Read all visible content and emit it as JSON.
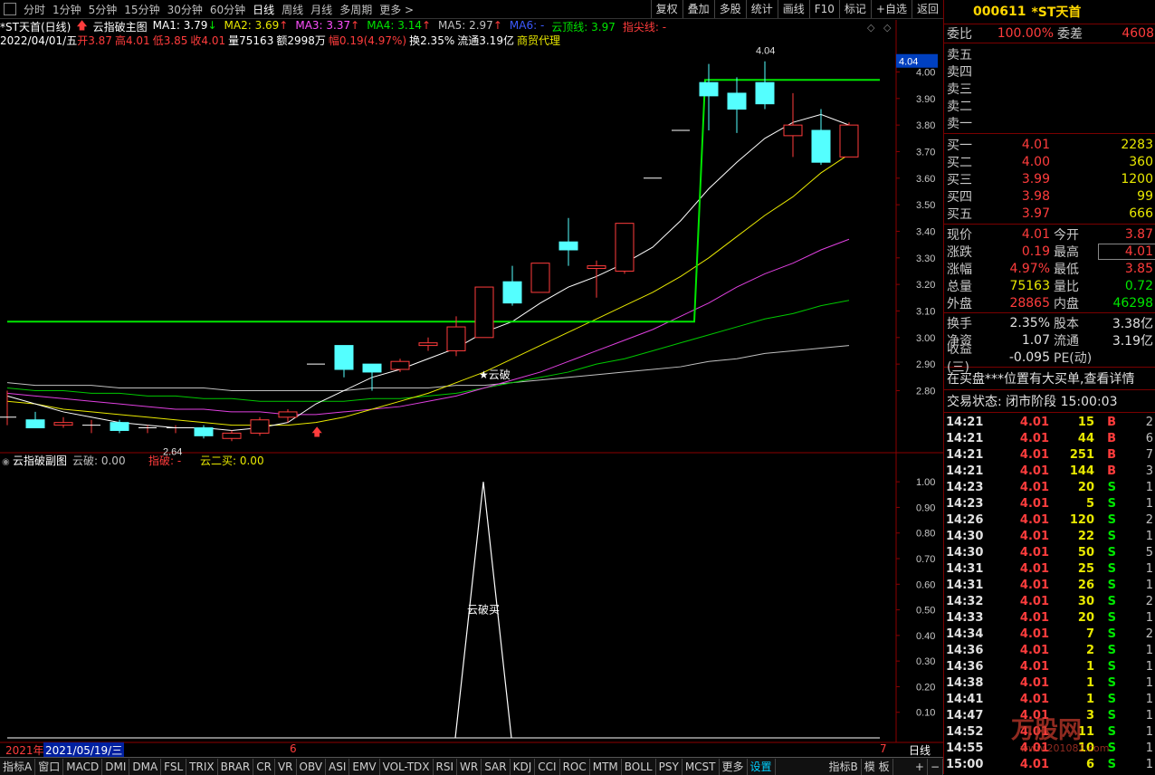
{
  "topbar": {
    "periods": [
      "分时",
      "1分钟",
      "5分钟",
      "15分钟",
      "30分钟",
      "60分钟",
      "日线",
      "周线",
      "月线",
      "多周期",
      "更多 >"
    ],
    "active_period": "日线",
    "buttons": [
      "复权",
      "叠加",
      "多股",
      "统计",
      "画线",
      "F10",
      "标记",
      "+自选",
      "返回"
    ]
  },
  "main": {
    "title": "*ST天首(日线)",
    "indicator_name": "云指破主图",
    "ma": [
      {
        "label": "MA1: 3.79",
        "arrow": "↓",
        "color": "#ffffff"
      },
      {
        "label": "MA2: 3.69",
        "arrow": "↑",
        "color": "#e8e800"
      },
      {
        "label": "MA3: 3.37",
        "arrow": "↑",
        "color": "#ff50ff"
      },
      {
        "label": "MA4: 3.14",
        "arrow": "↑",
        "color": "#00e600"
      },
      {
        "label": "MA5: 2.97",
        "arrow": "↑",
        "color": "#c0c0c0"
      },
      {
        "label": "MA6: -",
        "arrow": "",
        "color": "#3c5aff"
      },
      {
        "label": "云顶线: 3.97",
        "arrow": "",
        "color": "#00e600"
      },
      {
        "label": "指尖线: -",
        "arrow": "",
        "color": "#ff3c3c"
      }
    ],
    "date": "2022/04/01/五",
    "ohlc": {
      "open": "开3.87",
      "high": "高4.01",
      "low": "低3.85",
      "close": "收4.01",
      "vol": "量75163",
      "amount": "额2998万",
      "change": "幅0.19(4.97%)",
      "turnover": "换2.35%",
      "float": "流通3.19亿",
      "sector": "商贸代理"
    },
    "y_ticks": [
      "4.00",
      "3.90",
      "3.80",
      "3.70",
      "3.60",
      "3.50",
      "3.40",
      "3.30",
      "3.20",
      "3.10",
      "3.00",
      "2.90",
      "2.80"
    ],
    "current_price_tag": "4.04",
    "max_label": "4.04",
    "min_label": "2.64",
    "signal_label": "★云破"
  },
  "sub": {
    "title": "云指破副图",
    "vals": [
      {
        "label": "云破: 0.00",
        "color": "#c0c0c0"
      },
      {
        "label": "指破: -",
        "color": "#ff3c3c"
      },
      {
        "label": "云二买: 0.00",
        "color": "#e8e800"
      }
    ],
    "y_ticks": [
      "1.00",
      "0.90",
      "0.80",
      "0.70",
      "0.60",
      "0.50",
      "0.40",
      "0.30",
      "0.20",
      "0.10"
    ],
    "signal_label": "云破买"
  },
  "datebar": {
    "year": "2021年",
    "date": "2021/05/19/三",
    "mark6": "6",
    "mark7": "7",
    "period": "日线"
  },
  "bottombar": [
    "指标A",
    "窗口",
    "MACD",
    "DMI",
    "DMA",
    "FSL",
    "TRIX",
    "BRAR",
    "CR",
    "VR",
    "OBV",
    "ASI",
    "EMV",
    "VOL-TDX",
    "RSI",
    "WR",
    "SAR",
    "KDJ",
    "CCI",
    "ROC",
    "MTM",
    "BOLL",
    "PSY",
    "MCST",
    "更多",
    "设置",
    "指标B",
    "模 板"
  ],
  "panel": {
    "code": "000611",
    "name": "*ST天首",
    "weibi_label": "委比",
    "weibi": "100.00%",
    "weicha_label": "委差",
    "weicha": "4608",
    "sells": [
      {
        "label": "卖五",
        "price": "",
        "vol": ""
      },
      {
        "label": "卖四",
        "price": "",
        "vol": ""
      },
      {
        "label": "卖三",
        "price": "",
        "vol": ""
      },
      {
        "label": "卖二",
        "price": "",
        "vol": ""
      },
      {
        "label": "卖一",
        "price": "",
        "vol": ""
      }
    ],
    "buys": [
      {
        "label": "买一",
        "price": "4.01",
        "vol": "2283"
      },
      {
        "label": "买二",
        "price": "4.00",
        "vol": "360"
      },
      {
        "label": "买三",
        "price": "3.99",
        "vol": "1200"
      },
      {
        "label": "买四",
        "price": "3.98",
        "vol": "99"
      },
      {
        "label": "买五",
        "price": "3.97",
        "vol": "666"
      }
    ],
    "stats": [
      {
        "l1": "现价",
        "v1": "4.01",
        "c1": "#ff3c3c",
        "l2": "今开",
        "v2": "3.87",
        "c2": "#ff3c3c"
      },
      {
        "l1": "涨跌",
        "v1": "0.19",
        "c1": "#ff3c3c",
        "l2": "最高",
        "v2": "4.01",
        "c2": "#ff3c3c"
      },
      {
        "l1": "涨幅",
        "v1": "4.97%",
        "c1": "#ff3c3c",
        "l2": "最低",
        "v2": "3.85",
        "c2": "#ff3c3c"
      },
      {
        "l1": "总量",
        "v1": "75163",
        "c1": "#e8e800",
        "l2": "量比",
        "v2": "0.72",
        "c2": "#00e600"
      },
      {
        "l1": "外盘",
        "v1": "28865",
        "c1": "#ff3c3c",
        "l2": "内盘",
        "v2": "46298",
        "c2": "#00e600"
      }
    ],
    "stats2": [
      {
        "l1": "换手",
        "v1": "2.35%",
        "l2": "股本",
        "v2": "3.38亿"
      },
      {
        "l1": "净资",
        "v1": "1.07",
        "l2": "流通",
        "v2": "3.19亿"
      },
      {
        "l1": "收益(三)",
        "v1": "-0.095",
        "l2": "PE(动)",
        "v2": ""
      }
    ],
    "notice": "在买盘***位置有大买单,查看详情",
    "status": "交易状态: 闭市阶段 15:00:03",
    "ticks": [
      {
        "t": "14:21",
        "p": "4.01",
        "v": "15",
        "bs": "B",
        "n": "2"
      },
      {
        "t": "14:21",
        "p": "4.01",
        "v": "44",
        "bs": "B",
        "n": "6"
      },
      {
        "t": "14:21",
        "p": "4.01",
        "v": "251",
        "bs": "B",
        "n": "7"
      },
      {
        "t": "14:21",
        "p": "4.01",
        "v": "144",
        "bs": "B",
        "n": "3"
      },
      {
        "t": "14:23",
        "p": "4.01",
        "v": "20",
        "bs": "S",
        "n": "1"
      },
      {
        "t": "14:23",
        "p": "4.01",
        "v": "5",
        "bs": "S",
        "n": "1"
      },
      {
        "t": "14:26",
        "p": "4.01",
        "v": "120",
        "bs": "S",
        "n": "2"
      },
      {
        "t": "14:30",
        "p": "4.01",
        "v": "22",
        "bs": "S",
        "n": "1"
      },
      {
        "t": "14:30",
        "p": "4.01",
        "v": "50",
        "bs": "S",
        "n": "5"
      },
      {
        "t": "14:31",
        "p": "4.01",
        "v": "25",
        "bs": "S",
        "n": "1"
      },
      {
        "t": "14:31",
        "p": "4.01",
        "v": "26",
        "bs": "S",
        "n": "1"
      },
      {
        "t": "14:32",
        "p": "4.01",
        "v": "30",
        "bs": "S",
        "n": "2"
      },
      {
        "t": "14:33",
        "p": "4.01",
        "v": "20",
        "bs": "S",
        "n": "1"
      },
      {
        "t": "14:34",
        "p": "4.01",
        "v": "7",
        "bs": "S",
        "n": "2"
      },
      {
        "t": "14:36",
        "p": "4.01",
        "v": "2",
        "bs": "S",
        "n": "1"
      },
      {
        "t": "14:36",
        "p": "4.01",
        "v": "1",
        "bs": "S",
        "n": "1"
      },
      {
        "t": "14:38",
        "p": "4.01",
        "v": "1",
        "bs": "S",
        "n": "1"
      },
      {
        "t": "14:41",
        "p": "4.01",
        "v": "1",
        "bs": "S",
        "n": "1"
      },
      {
        "t": "14:47",
        "p": "4.01",
        "v": "3",
        "bs": "S",
        "n": "1"
      },
      {
        "t": "14:52",
        "p": "4.01",
        "v": "11",
        "bs": "S",
        "n": "1"
      },
      {
        "t": "14:55",
        "p": "4.01",
        "v": "10",
        "bs": "S",
        "n": "1"
      },
      {
        "t": "15:00",
        "p": "4.01",
        "v": "6",
        "bs": "S",
        "n": "1"
      }
    ],
    "watermark": "万股网",
    "watermark_url": "www.201082.com"
  },
  "chart_data": {
    "type": "candlestick",
    "candles": [
      {
        "o": 2.7,
        "h": 2.8,
        "l": 2.67,
        "c": 2.7
      },
      {
        "o": 2.69,
        "h": 2.72,
        "l": 2.67,
        "c": 2.66
      },
      {
        "o": 2.67,
        "h": 2.7,
        "l": 2.66,
        "c": 2.68
      },
      {
        "o": 2.67,
        "h": 2.69,
        "l": 2.64,
        "c": 2.67
      },
      {
        "o": 2.68,
        "h": 2.69,
        "l": 2.64,
        "c": 2.65
      },
      {
        "o": 2.66,
        "h": 2.67,
        "l": 2.64,
        "c": 2.66
      },
      {
        "o": 2.66,
        "h": 2.67,
        "l": 2.64,
        "c": 2.66
      },
      {
        "o": 2.66,
        "h": 2.67,
        "l": 2.62,
        "c": 2.63
      },
      {
        "o": 2.62,
        "h": 2.65,
        "l": 2.61,
        "c": 2.64
      },
      {
        "o": 2.64,
        "h": 2.7,
        "l": 2.63,
        "c": 2.69
      },
      {
        "o": 2.7,
        "h": 2.73,
        "l": 2.68,
        "c": 2.72
      },
      {
        "o": 2.9,
        "h": 2.9,
        "l": 2.9,
        "c": 2.9
      },
      {
        "o": 2.97,
        "h": 2.97,
        "l": 2.85,
        "c": 2.88
      },
      {
        "o": 2.9,
        "h": 2.9,
        "l": 2.8,
        "c": 2.87
      },
      {
        "o": 2.88,
        "h": 2.92,
        "l": 2.87,
        "c": 2.91
      },
      {
        "o": 2.97,
        "h": 3.0,
        "l": 2.95,
        "c": 2.98
      },
      {
        "o": 2.95,
        "h": 3.08,
        "l": 2.93,
        "c": 3.04
      },
      {
        "o": 3.0,
        "h": 3.19,
        "l": 3.0,
        "c": 3.19
      },
      {
        "o": 3.21,
        "h": 3.27,
        "l": 3.12,
        "c": 3.13
      },
      {
        "o": 3.17,
        "h": 3.28,
        "l": 3.17,
        "c": 3.28
      },
      {
        "o": 3.36,
        "h": 3.45,
        "l": 3.27,
        "c": 3.33
      },
      {
        "o": 3.26,
        "h": 3.29,
        "l": 3.15,
        "c": 3.27
      },
      {
        "o": 3.25,
        "h": 3.43,
        "l": 3.24,
        "c": 3.43
      },
      {
        "o": 3.6,
        "h": 3.6,
        "l": 3.6,
        "c": 3.6
      },
      {
        "o": 3.78,
        "h": 3.78,
        "l": 3.78,
        "c": 3.78
      },
      {
        "o": 3.96,
        "h": 4.03,
        "l": 3.78,
        "c": 3.91
      },
      {
        "o": 3.92,
        "h": 3.98,
        "l": 3.77,
        "c": 3.86
      },
      {
        "o": 3.96,
        "h": 4.04,
        "l": 3.86,
        "c": 3.88
      },
      {
        "o": 3.76,
        "h": 3.92,
        "l": 3.68,
        "c": 3.8
      },
      {
        "o": 3.78,
        "h": 3.86,
        "l": 3.65,
        "c": 3.66
      },
      {
        "o": 3.68,
        "h": 3.81,
        "l": 3.68,
        "c": 3.8
      }
    ],
    "ma1": [
      2.78,
      2.75,
      2.72,
      2.7,
      2.68,
      2.67,
      2.66,
      2.66,
      2.65,
      2.66,
      2.68,
      2.75,
      2.8,
      2.85,
      2.88,
      2.92,
      2.96,
      3.02,
      3.06,
      3.13,
      3.19,
      3.23,
      3.28,
      3.34,
      3.44,
      3.56,
      3.66,
      3.75,
      3.81,
      3.84,
      3.8
    ],
    "ma2": [
      2.76,
      2.75,
      2.73,
      2.72,
      2.71,
      2.7,
      2.69,
      2.68,
      2.67,
      2.67,
      2.67,
      2.68,
      2.7,
      2.73,
      2.76,
      2.79,
      2.83,
      2.87,
      2.92,
      2.97,
      3.02,
      3.07,
      3.12,
      3.17,
      3.23,
      3.3,
      3.38,
      3.46,
      3.53,
      3.62,
      3.69
    ],
    "ma3": [
      2.79,
      2.78,
      2.77,
      2.76,
      2.75,
      2.74,
      2.73,
      2.73,
      2.72,
      2.72,
      2.71,
      2.71,
      2.72,
      2.73,
      2.74,
      2.76,
      2.78,
      2.81,
      2.84,
      2.87,
      2.91,
      2.95,
      2.99,
      3.03,
      3.08,
      3.13,
      3.19,
      3.24,
      3.28,
      3.33,
      3.37
    ],
    "ma4": [
      2.81,
      2.8,
      2.8,
      2.79,
      2.79,
      2.78,
      2.78,
      2.77,
      2.77,
      2.76,
      2.76,
      2.76,
      2.76,
      2.77,
      2.77,
      2.78,
      2.79,
      2.81,
      2.83,
      2.85,
      2.87,
      2.9,
      2.92,
      2.95,
      2.98,
      3.01,
      3.04,
      3.07,
      3.09,
      3.12,
      3.14
    ],
    "ma5": [
      2.83,
      2.82,
      2.82,
      2.82,
      2.81,
      2.81,
      2.81,
      2.81,
      2.8,
      2.8,
      2.8,
      2.8,
      2.8,
      2.81,
      2.81,
      2.81,
      2.82,
      2.82,
      2.83,
      2.84,
      2.85,
      2.86,
      2.87,
      2.88,
      2.89,
      2.91,
      2.92,
      2.94,
      2.95,
      2.96,
      2.97
    ],
    "cloud_top": {
      "before": 3.06,
      "after": 3.97,
      "switch_index": 25
    },
    "sub_signal": {
      "index": 17,
      "value": 1.0
    },
    "ylim": [
      2.58,
      4.08
    ],
    "sub_ylim": [
      0,
      1.05
    ]
  }
}
